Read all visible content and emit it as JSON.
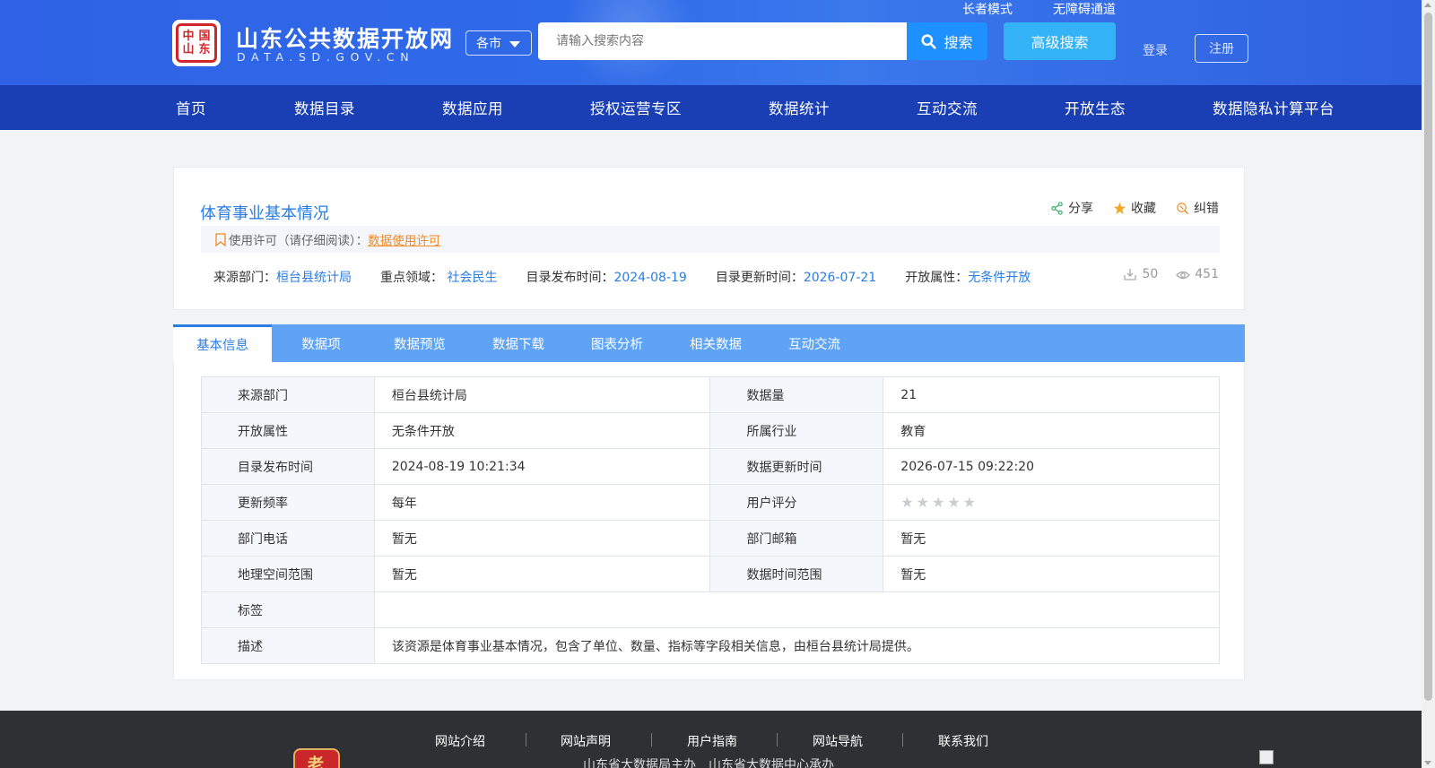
{
  "header": {
    "site_title": "山东公共数据开放网",
    "site_subtitle": "DATA.SD.GOV.CN",
    "logo_chars": [
      "中",
      "国",
      "山",
      "东"
    ],
    "city_select": "各市",
    "search_placeholder": "请输入搜索内容",
    "search_label": "搜索",
    "advanced_search": "高级搜索",
    "elder_mode": "长者模式",
    "accessibility": "无障碍通道",
    "login": "登录",
    "register": "注册"
  },
  "nav": {
    "items": [
      "首页",
      "数据目录",
      "数据应用",
      "授权运营专区",
      "数据统计",
      "互动交流",
      "开放生态",
      "数据隐私计算平台"
    ]
  },
  "dataset": {
    "title": "体育事业基本情况",
    "actions": {
      "share": "分享",
      "favorite": "收藏",
      "correct": "纠错"
    },
    "license_label": "使用许可（请仔细阅读）：",
    "license_link": "数据使用许可",
    "meta": {
      "source_label": "来源部门：",
      "source": "桓台县统计局",
      "domain_label": "重点领域：",
      "domain": "社会民生",
      "publish_label": "目录发布时间：",
      "publish": "2024-08-19",
      "update_label": "目录更新时间：",
      "update": "2026-07-21",
      "open_label": "开放属性：",
      "open": "无条件开放"
    },
    "downloads": "50",
    "views": "451"
  },
  "tabs": [
    "基本信息",
    "数据项",
    "数据预览",
    "数据下载",
    "图表分析",
    "相关数据",
    "互动交流"
  ],
  "info": {
    "rows": [
      {
        "k1": "来源部门",
        "v1": "桓台县统计局",
        "k2": "数据量",
        "v2": "21"
      },
      {
        "k1": "开放属性",
        "v1": "无条件开放",
        "k2": "所属行业",
        "v2": "教育"
      },
      {
        "k1": "目录发布时间",
        "v1": "2024-08-19 10:21:34",
        "k2": "数据更新时间",
        "v2": "2026-07-15 09:22:20"
      },
      {
        "k1": "更新频率",
        "v1": "每年",
        "k2": "用户评分",
        "v2": ""
      },
      {
        "k1": "部门电话",
        "v1": "暂无",
        "k2": "部门邮箱",
        "v2": "暂无"
      },
      {
        "k1": "地理空间范围",
        "v1": "暂无",
        "k2": "数据时间范围",
        "v2": "暂无"
      }
    ],
    "tag_label": "标签",
    "tag_value": "",
    "desc_label": "描述",
    "desc_value": "该资源是体育事业基本情况，包含了单位、数量、指标等字段相关信息，由桓台县统计局提供。",
    "rating_stars": 0,
    "rating_max": 5
  },
  "footer": {
    "links": [
      "网站介绍",
      "网站声明",
      "用户指南",
      "网站导航",
      "联系我们"
    ],
    "line2": "山东省大数据局主办　山东省大数据中心承办",
    "badge": "老"
  },
  "colors": {
    "accent": "#2a7de1",
    "nav_bg": "#1a3fb5",
    "tab_bg": "#5fa3f6",
    "license_link": "#f08a24"
  }
}
